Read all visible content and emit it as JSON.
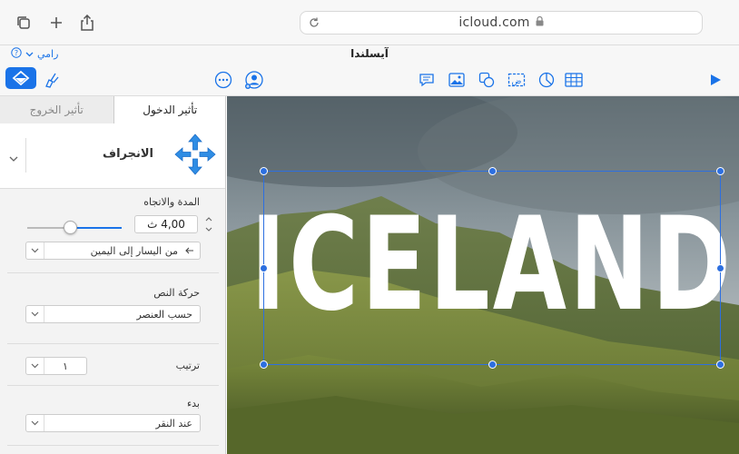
{
  "browser": {
    "url": "icloud.com"
  },
  "document": {
    "title": "آيسلندا",
    "account_name": "رامي"
  },
  "colors": {
    "accent": "#1a73e8",
    "selection": "#2d6fe0"
  },
  "toolbar": {
    "icons": [
      "text-icon",
      "image-icon",
      "shape-icon",
      "textbox-icon",
      "chart-icon",
      "table-icon",
      "play-icon",
      "more-icon",
      "collaborate-icon",
      "format-icon",
      "animate-icon"
    ]
  },
  "sidebar": {
    "tabs": {
      "build_in": "تأثير الدخول",
      "build_out": "تأثير الخروج"
    },
    "effect": {
      "name": "الانجراف"
    },
    "duration": {
      "label": "المدة والاتجاه",
      "value": "4,00 ث",
      "slider_fraction": 0.45,
      "direction": "من اليسار إلى اليمين"
    },
    "text_delivery": {
      "label": "حركة النص",
      "value": "حسب العنصر"
    },
    "order": {
      "label": "ترتيب",
      "value": "١"
    },
    "start": {
      "label": "بدء",
      "value": "عند النقر"
    }
  },
  "slide": {
    "text": "ICELAND"
  }
}
